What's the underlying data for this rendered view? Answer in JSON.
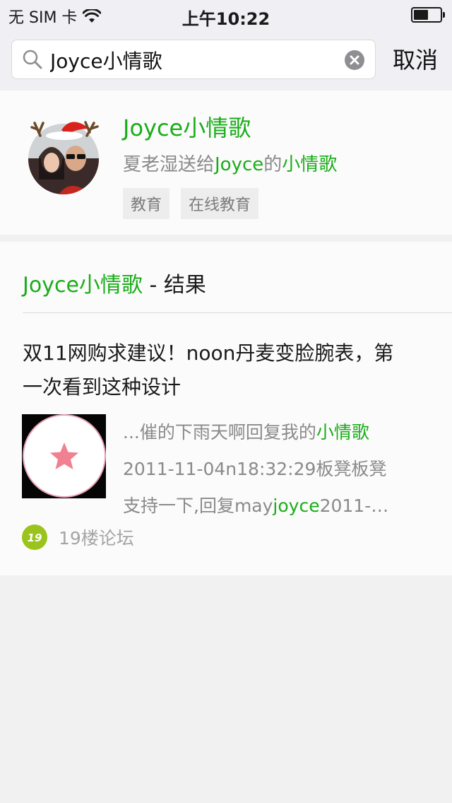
{
  "status_bar": {
    "carrier": "无 SIM 卡",
    "time": "上午10:22"
  },
  "search": {
    "query": "Joyce小情歌",
    "cancel_label": "取消"
  },
  "account": {
    "name": "Joyce小情歌",
    "desc_prefix": "夏老湿送给",
    "desc_hl1": "Joyce",
    "desc_mid": "的",
    "desc_hl2": "小情歌",
    "tags": [
      "教育",
      "在线教育"
    ]
  },
  "results": {
    "header_keyword": "Joyce小情歌",
    "header_suffix": " - 结果",
    "article": {
      "title": "双11网购求建议！noon丹麦变脸腕表，第一次看到这种设计",
      "snippet_line1_prefix": "...催的下雨天啊回复我的",
      "snippet_line1_hl": "小情歌",
      "snippet_line2": "2011-11-04n18:32:29板凳板凳",
      "snippet_line3_prefix": "支持一下,回复may",
      "snippet_line3_hl": "joyce",
      "snippet_line3_suffix": "2011-…",
      "source_logo_text": "19",
      "source": "19楼论坛"
    }
  },
  "colors": {
    "accent": "#1aad19",
    "secondary_text": "#8a8a8a",
    "background": "#f1f1f1"
  }
}
